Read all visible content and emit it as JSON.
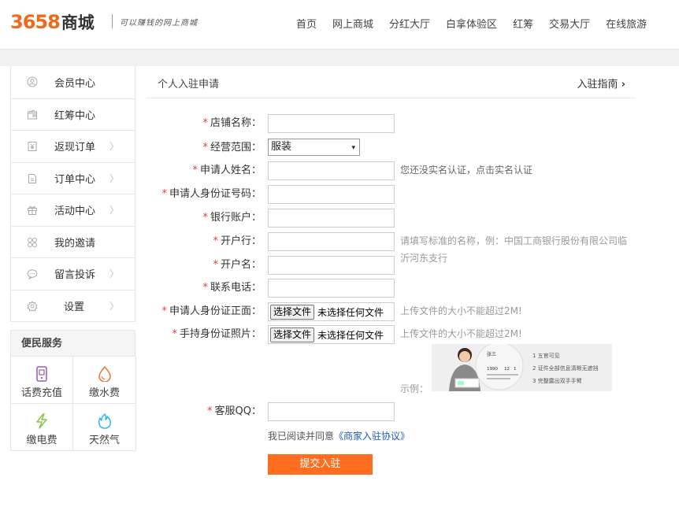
{
  "header": {
    "logo_number": "3658",
    "logo_text": "商城",
    "slogan": "可以赚钱的网上商城",
    "nav": [
      "首页",
      "网上商城",
      "分红大厅",
      "白拿体验区",
      "红筹",
      "交易大厅",
      "在线旅游"
    ]
  },
  "sidebar": {
    "items": [
      {
        "label": "会员中心",
        "icon": "user-icon",
        "arrow": false
      },
      {
        "label": "红筹中心",
        "icon": "wallet-icon",
        "arrow": false
      },
      {
        "label": "返现订单",
        "icon": "yen-doc-icon",
        "arrow": true
      },
      {
        "label": "订单中心",
        "icon": "document-icon",
        "arrow": true
      },
      {
        "label": "活动中心",
        "icon": "gift-icon",
        "arrow": true
      },
      {
        "label": "我的邀请",
        "icon": "invite-icon",
        "arrow": false
      },
      {
        "label": "留言投诉",
        "icon": "chat-icon",
        "arrow": true
      },
      {
        "label": "设置",
        "icon": "gear-icon",
        "arrow": true
      }
    ],
    "arrow_glyph": "〉",
    "service_title": "便民服务",
    "services": [
      {
        "label": "话费充值",
        "icon": "phone-recharge-icon",
        "color": "#9b59b6"
      },
      {
        "label": "缴水费",
        "icon": "water-drop-icon",
        "color": "#e8743b"
      },
      {
        "label": "缴电费",
        "icon": "lightning-icon",
        "color": "#8bc34a"
      },
      {
        "label": "天然气",
        "icon": "flame-icon",
        "color": "#29b6f6"
      }
    ]
  },
  "main": {
    "title": "个人入驻申请",
    "guide": "入驻指南",
    "guide_arrow": "›",
    "required_mark": "*",
    "fields": {
      "shop_name": {
        "label": "店铺名称：",
        "value": ""
      },
      "scope": {
        "label": "经营范围：",
        "value": "服装"
      },
      "applicant_name": {
        "label": "申请人姓名：",
        "value": ""
      },
      "applicant_id": {
        "label": "申请人身份证号码：",
        "value": ""
      },
      "bank_account": {
        "label": "银行账户：",
        "value": ""
      },
      "bank_branch": {
        "label": "开户行：",
        "value": ""
      },
      "account_name": {
        "label": "开户名：",
        "value": ""
      },
      "phone": {
        "label": "联系电话：",
        "value": ""
      },
      "id_front": {
        "label": "申请人身份证正面："
      },
      "id_hand": {
        "label": "手持身份证照片："
      },
      "qq": {
        "label": "客服QQ：",
        "value": ""
      }
    },
    "file_button": "选择文件",
    "file_none": "未选择任何文件",
    "hints": {
      "realname": "您还没实名认证，点击实名认证",
      "bank_line1": "请填写标准的名称，例：中国工商银行股份有限公司临",
      "bank_line2": "沂河东支行",
      "file_size": "上传文件的大小不能超过2M!"
    },
    "sample_label": "示例：",
    "sample": {
      "steps": [
        "1  五官可见",
        "2  证件全部信息清晰无遮挡",
        "3  完整露出双手手臂"
      ],
      "card_name": "张三",
      "card_year": "1990",
      "card_month": "12",
      "card_day": "1"
    },
    "agree_text": "我已阅读并同意",
    "agree_link": "《商家入驻协议》",
    "submit": "提交入驻"
  }
}
